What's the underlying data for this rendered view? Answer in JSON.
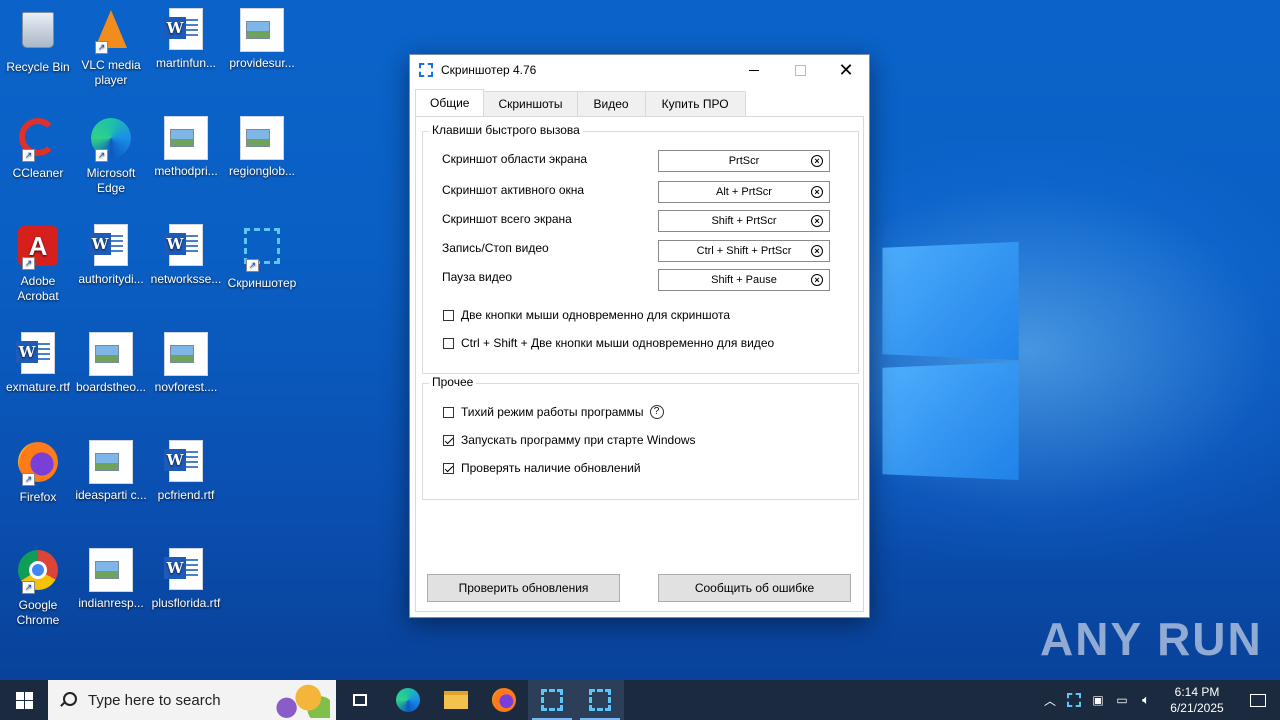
{
  "desktop": {
    "icons": [
      {
        "label": "Recycle Bin"
      },
      {
        "label": "VLC media player"
      },
      {
        "label": "martinfun..."
      },
      {
        "label": "providesur..."
      },
      {
        "label": "CCleaner"
      },
      {
        "label": "Microsoft Edge"
      },
      {
        "label": "methodpri..."
      },
      {
        "label": "regionglob..."
      },
      {
        "label": "Adobe Acrobat"
      },
      {
        "label": "authoritydi..."
      },
      {
        "label": "networksse..."
      },
      {
        "label": "Скриншотер"
      },
      {
        "label": "exmature.rtf"
      },
      {
        "label": "boardstheo..."
      },
      {
        "label": "novforest...."
      },
      {
        "label": "Firefox"
      },
      {
        "label": "ideasparti c..."
      },
      {
        "label": "pcfriend.rtf"
      },
      {
        "label": "Google Chrome"
      },
      {
        "label": "indianresp..."
      },
      {
        "label": "plusflorida.rtf"
      }
    ],
    "watermark": "ANY RUN"
  },
  "window": {
    "title": "Скриншотер 4.76",
    "tabs": [
      {
        "label": "Общие",
        "active": true
      },
      {
        "label": "Скриншоты",
        "active": false
      },
      {
        "label": "Видео",
        "active": false
      },
      {
        "label": "Купить ПРО",
        "active": false
      }
    ],
    "hotkeys_group": {
      "legend": "Клавиши быстрого вызова",
      "rows": [
        {
          "label": "Скриншот области экрана",
          "value": "PrtScr"
        },
        {
          "label": "Скриншот активного окна",
          "value": "Alt + PrtScr"
        },
        {
          "label": "Скриншот всего экрана",
          "value": "Shift + PrtScr"
        },
        {
          "label": "Запись/Стоп видео",
          "value": "Ctrl + Shift + PrtScr"
        },
        {
          "label": "Пауза видео",
          "value": "Shift + Pause"
        }
      ],
      "checkboxes": [
        {
          "label": "Две кнопки мыши одновременно для скриншота",
          "checked": false
        },
        {
          "label": "Ctrl + Shift + Две кнопки мыши одновременно для видео",
          "checked": false
        }
      ]
    },
    "other_group": {
      "legend": "Прочее",
      "checkboxes": [
        {
          "label": "Тихий режим работы программы",
          "checked": false
        },
        {
          "label": "Запускать программу при старте Windows",
          "checked": true
        },
        {
          "label": "Проверять наличие обновлений",
          "checked": true
        }
      ]
    },
    "buttons": {
      "check_updates": "Проверить обновления",
      "report_bug": "Сообщить об ошибке"
    }
  },
  "taskbar": {
    "search_placeholder": "Type here to search",
    "time": "6:14 PM",
    "date": "6/21/2025"
  },
  "colors": {
    "desktop_bg": "#0a5fc4",
    "taskbar_bg": "#1b2a3f",
    "accent": "#1c6ee8"
  }
}
